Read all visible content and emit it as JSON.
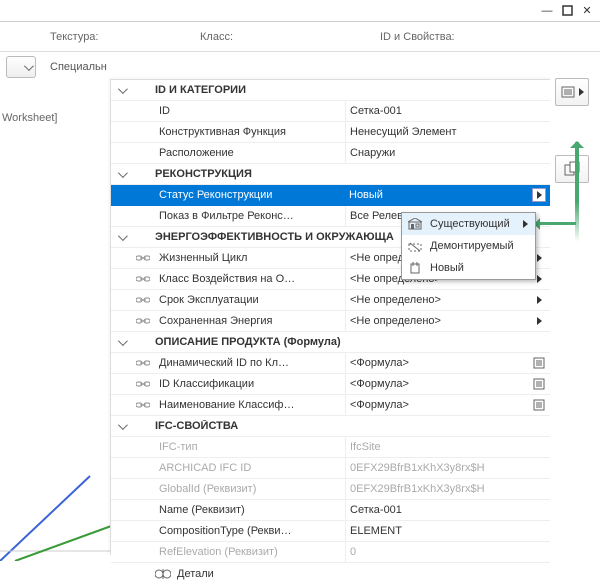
{
  "header": {
    "texture": "Текстура:",
    "class": "Класс:",
    "idprops": "ID и Свойства:"
  },
  "special": "Специальн",
  "worksheet": "Worksheet]",
  "sections": {
    "idcat": "ID И КАТЕГОРИИ",
    "recon": "РЕКОНСТРУКЦИЯ",
    "energy": "ЭНЕРГОЭФФЕКТИВНОСТЬ И ОКРУЖАЮЩА",
    "desc": "ОПИСАНИЕ ПРОДУКТА (Формула)",
    "ifc": "IFC-СВОЙСТВА"
  },
  "rows": {
    "id": {
      "label": "ID",
      "value": "Сетка-001"
    },
    "func": {
      "label": "Конструктивная Функция",
      "value": "Ненесущий Элемент"
    },
    "loc": {
      "label": "Расположение",
      "value": "Снаружи"
    },
    "status": {
      "label": "Статус Реконструкции",
      "value": "Новый"
    },
    "filter": {
      "label": "Показ в Фильтре Реконс…",
      "value": "Все Релевантные"
    },
    "life": {
      "label": "Жизненный Цикл",
      "value": "<Не определено>"
    },
    "envclass": {
      "label": "Класс Воздействия на О…",
      "value": "<Не определено>"
    },
    "lifespan": {
      "label": "Срок Эксплуатации",
      "value": "<Не определено>"
    },
    "energy": {
      "label": "Сохраненная Энергия",
      "value": "<Не определено>"
    },
    "dynid": {
      "label": "Динамический ID по Кл…",
      "value": "<Формула>"
    },
    "classid": {
      "label": "ID Классификации",
      "value": "<Формула>"
    },
    "classname": {
      "label": "Наименование Классиф…",
      "value": "<Формула>"
    },
    "ifctype": {
      "label": "IFC-тип",
      "value": "IfcSite"
    },
    "archid": {
      "label": "ARCHICAD IFC ID",
      "value": "0EFX29BfrB1xKhX3y8rx$H"
    },
    "globalid": {
      "label": "GlobalId (Реквизит)",
      "value": "0EFX29BfrB1xKhX3y8rx$H"
    },
    "name": {
      "label": "Name (Реквизит)",
      "value": "Сетка-001"
    },
    "comptype": {
      "label": "CompositionType (Рекви…",
      "value": "ELEMENT"
    },
    "refelev": {
      "label": "RefElevation (Реквизит)",
      "value": "0"
    }
  },
  "popup": {
    "existing": "Существующий",
    "demo": "Демонтируемый",
    "new": "Новый"
  },
  "footer": "Детали"
}
